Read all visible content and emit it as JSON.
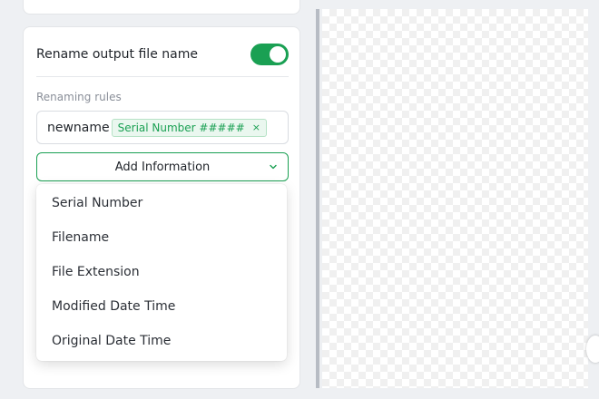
{
  "rename": {
    "label": "Rename output file name",
    "enabled": true
  },
  "rules": {
    "label": "Renaming rules",
    "prefix": "newname",
    "tag": "Serial Number #####",
    "tag_close": "×"
  },
  "add_info": {
    "label": "Add Information"
  },
  "dropdown": {
    "items": [
      "Serial Number",
      "Filename",
      "File Extension",
      "Modified Date Time",
      "Original Date Time"
    ]
  },
  "colors": {
    "accent": "#1aa053"
  }
}
